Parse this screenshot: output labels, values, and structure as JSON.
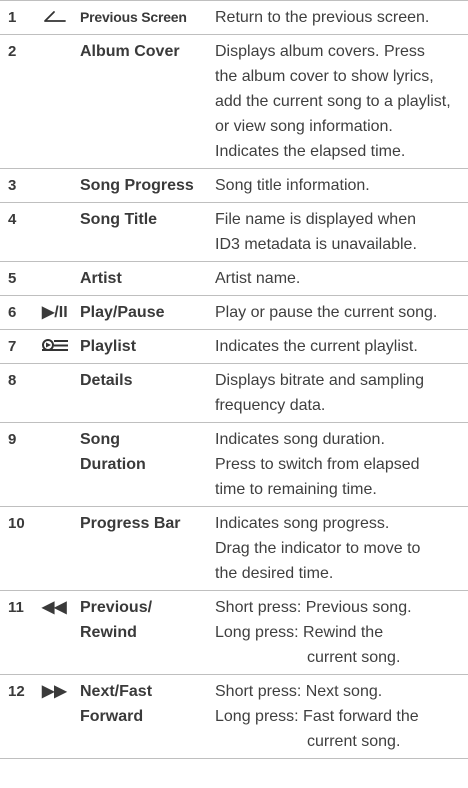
{
  "rows": [
    {
      "num": "1",
      "icon": "back-arrow-icon",
      "icon_text": "",
      "name": [
        "Previous Screen"
      ],
      "desc": [
        "Return to the previous screen."
      ]
    },
    {
      "num": "2",
      "icon": "",
      "icon_text": "",
      "name": [
        "Album Cover"
      ],
      "desc": [
        "Displays album covers. Press",
        "the album cover to show lyrics,",
        "add the current song to a playlist,",
        "or view song information.",
        "Indicates the elapsed time."
      ]
    },
    {
      "num": "3",
      "icon": "",
      "icon_text": "",
      "name": [
        "Song Progress"
      ],
      "desc": [
        "Song title information."
      ]
    },
    {
      "num": "4",
      "icon": "",
      "icon_text": "",
      "name": [
        "Song Title"
      ],
      "desc": [
        "File name is displayed when",
        "ID3 metadata is unavailable."
      ]
    },
    {
      "num": "5",
      "icon": "",
      "icon_text": "",
      "name": [
        "Artist"
      ],
      "desc": [
        "Artist name."
      ]
    },
    {
      "num": "6",
      "icon": "play-pause-icon",
      "icon_text": "▶/II",
      "name": [
        "Play/Pause"
      ],
      "desc": [
        "Play or pause the current song."
      ]
    },
    {
      "num": "7",
      "icon": "playlist-icon",
      "icon_text": "",
      "name": [
        "Playlist"
      ],
      "desc": [
        "Indicates the current playlist."
      ]
    },
    {
      "num": "8",
      "icon": "",
      "icon_text": "",
      "name": [
        "Details"
      ],
      "desc": [
        "Displays bitrate and sampling",
        "frequency data."
      ]
    },
    {
      "num": "9",
      "icon": "",
      "icon_text": "",
      "name": [
        "Song",
        "Duration"
      ],
      "desc": [
        "Indicates song duration.",
        "Press to switch from elapsed",
        "time to remaining time."
      ]
    },
    {
      "num": "10",
      "icon": "",
      "icon_text": "",
      "name": [
        "Progress Bar"
      ],
      "desc": [
        "Indicates song progress.",
        "Drag the indicator to move to",
        "the desired time."
      ]
    },
    {
      "num": "11",
      "icon": "rewind-icon",
      "icon_text": "◀◀",
      "name": [
        "Previous/",
        "Rewind"
      ],
      "desc": [
        "Short press: Previous song.",
        "Long press: Rewind the",
        "current song."
      ],
      "indent_last": true
    },
    {
      "num": "12",
      "icon": "fast-forward-icon",
      "icon_text": "▶▶",
      "name": [
        "Next/Fast",
        "Forward"
      ],
      "desc": [
        "Short press: Next song.",
        "Long press: Fast forward the",
        "current song."
      ],
      "indent_last": true
    }
  ]
}
